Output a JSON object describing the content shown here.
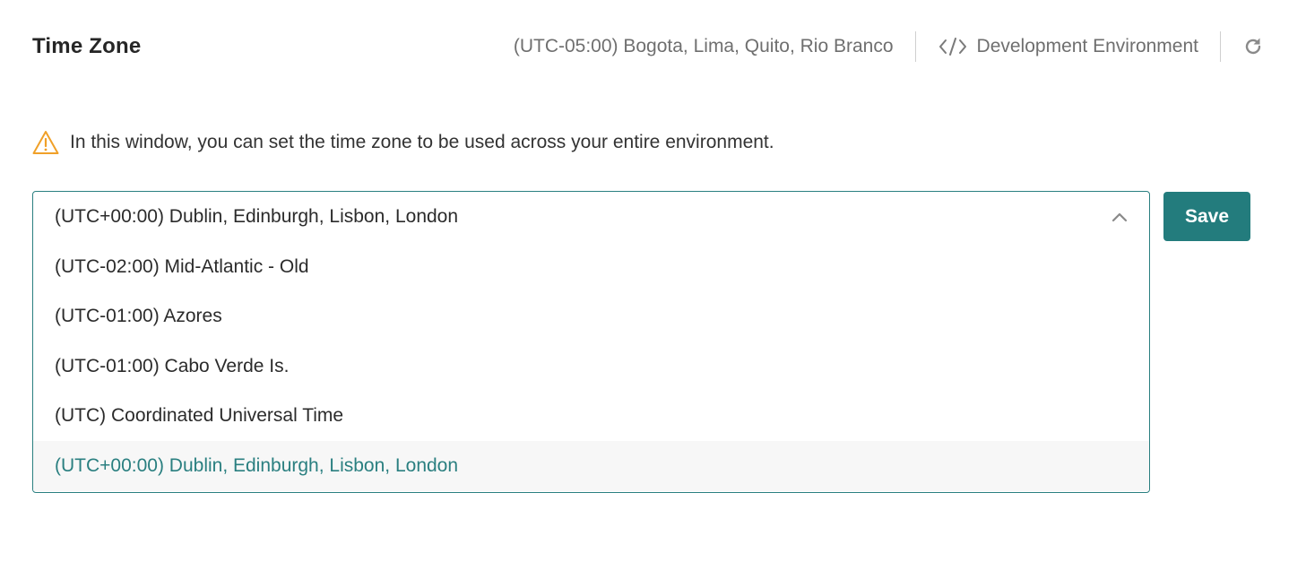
{
  "header": {
    "title": "Time Zone",
    "current_timezone": "(UTC-05:00) Bogota, Lima, Quito, Rio Branco",
    "environment_label": "Development Environment",
    "environment_icon": "code-icon",
    "refresh_icon": "refresh-icon"
  },
  "info": {
    "icon": "warning-icon",
    "text": "In this window, you can set the time zone to be used across your entire environment."
  },
  "timezone_select": {
    "selected": "(UTC+00:00) Dublin, Edinburgh, Lisbon, London",
    "expanded": true,
    "options": [
      "(UTC-02:00) Mid-Atlantic - Old",
      "(UTC-01:00) Azores",
      "(UTC-01:00) Cabo Verde Is.",
      "(UTC) Coordinated Universal Time",
      "(UTC+00:00) Dublin, Edinburgh, Lisbon, London"
    ],
    "active_index": 4
  },
  "actions": {
    "save_label": "Save"
  },
  "colors": {
    "accent": "#237c7d",
    "warning": "#f0a028",
    "muted_text": "#6f6f6f",
    "highlight_bg": "#f7f7f7"
  }
}
